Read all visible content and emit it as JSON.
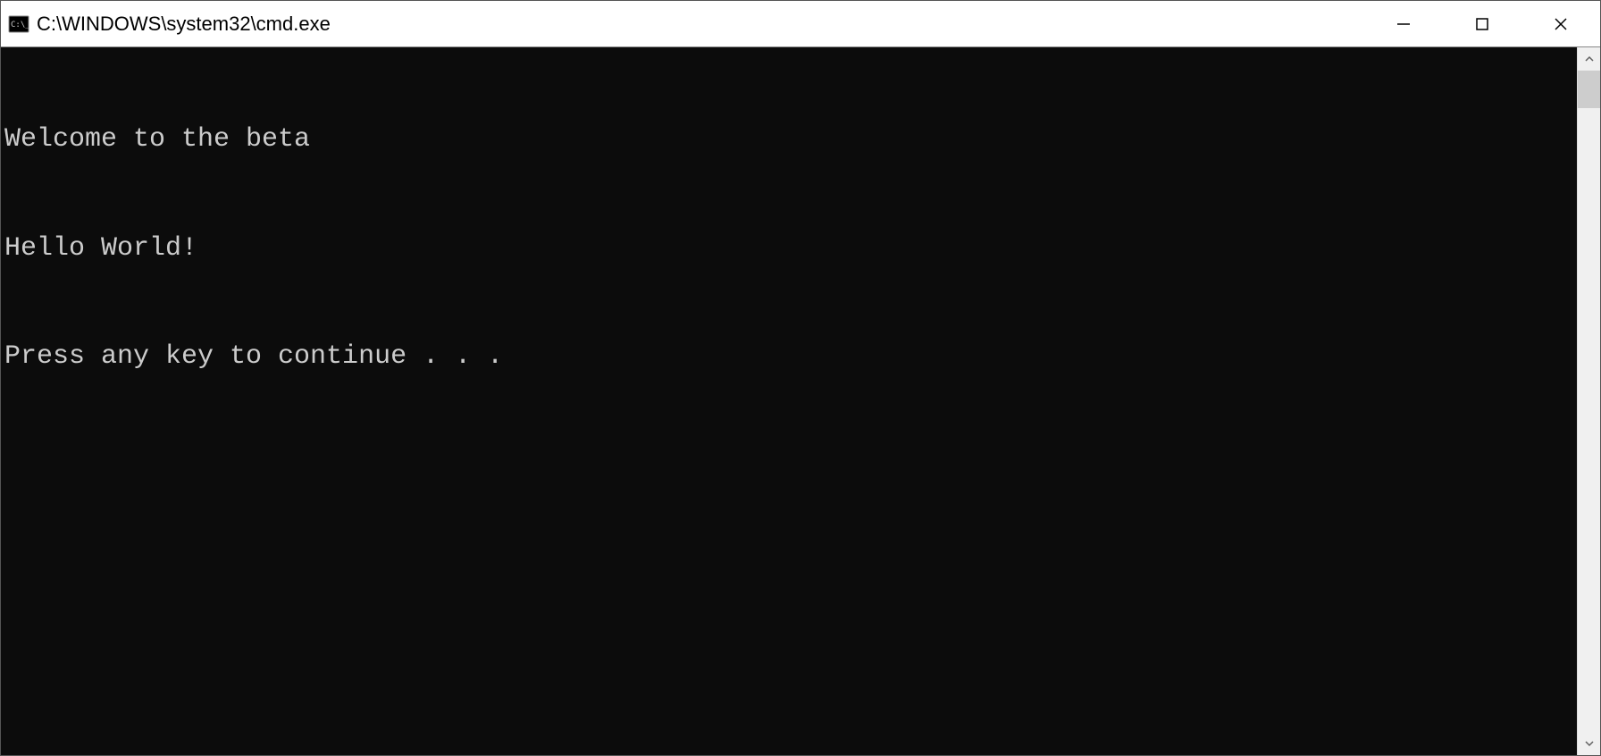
{
  "window": {
    "title": "C:\\WINDOWS\\system32\\cmd.exe"
  },
  "console": {
    "lines": [
      "Welcome to the beta",
      "Hello World!",
      "Press any key to continue . . ."
    ]
  }
}
